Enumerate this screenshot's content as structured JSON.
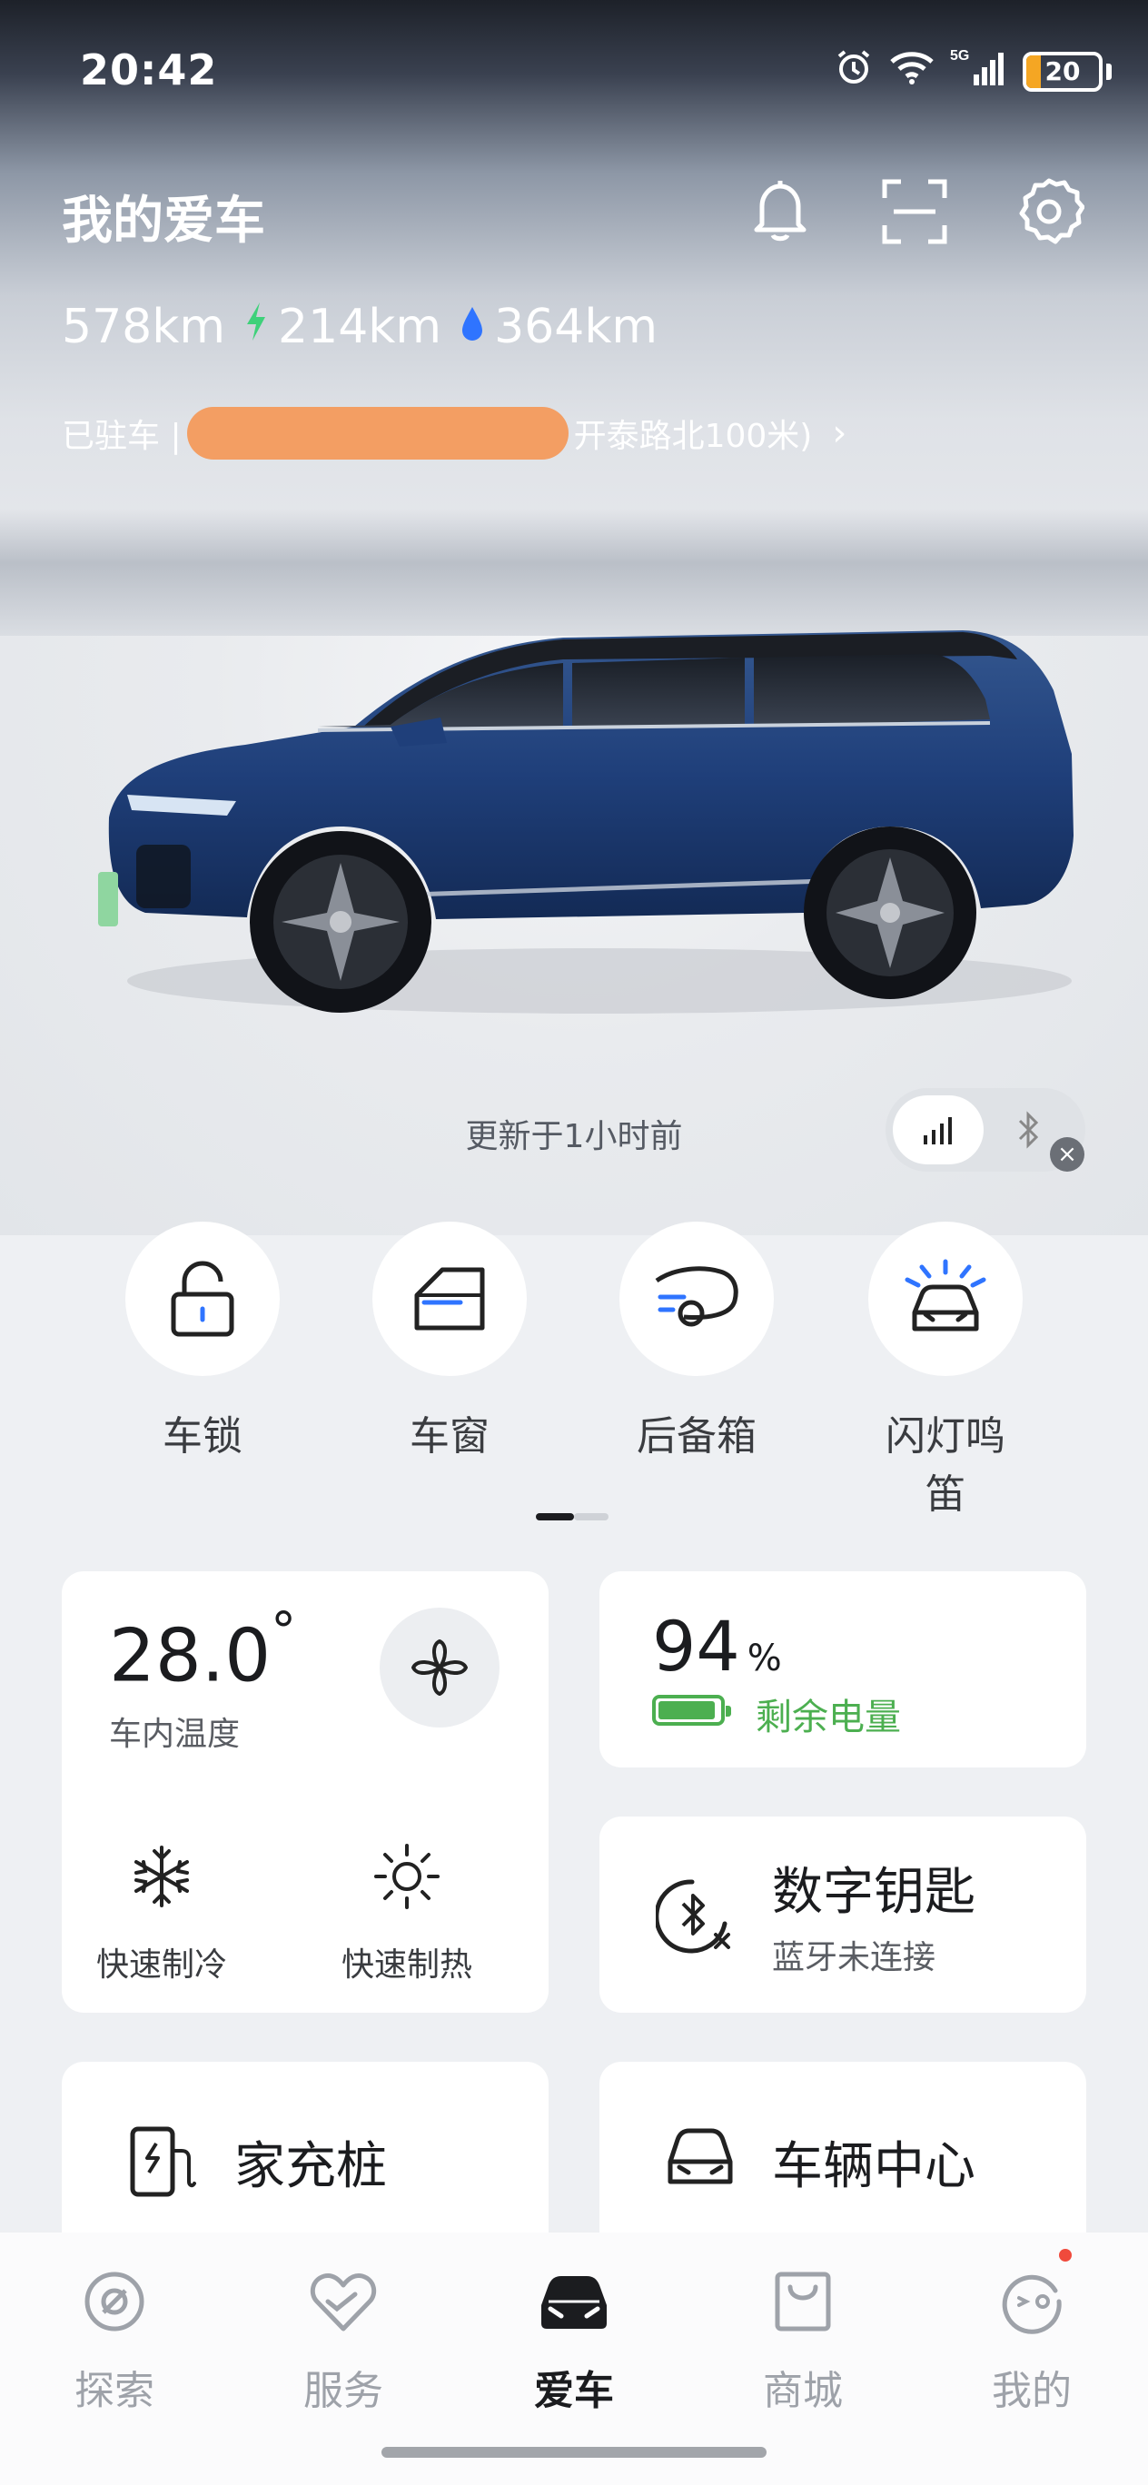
{
  "status": {
    "time": "20:42",
    "battery": "20",
    "network": "5G"
  },
  "header": {
    "title": "我的爱车"
  },
  "range": {
    "total": "578km",
    "electric": "214km",
    "fuel": "364km"
  },
  "parking": {
    "status": "已驻车 |",
    "location_tail": "开泰路北100米)"
  },
  "update": {
    "text": "更新于1小时前"
  },
  "quick_controls": [
    {
      "label": "车锁"
    },
    {
      "label": "车窗"
    },
    {
      "label": "后备箱"
    },
    {
      "label": "闪灯鸣笛"
    }
  ],
  "climate": {
    "temp": "28.0",
    "temp_unit": "°",
    "temp_label": "车内温度",
    "cool_label": "快速制冷",
    "heat_label": "快速制热"
  },
  "battery": {
    "percent": "94",
    "unit": "%",
    "label": "剩余电量",
    "level": 0.94
  },
  "digital_key": {
    "title": "数字钥匙",
    "status": "蓝牙未连接"
  },
  "shortcuts": [
    {
      "label": "家充桩"
    },
    {
      "label": "车辆中心"
    }
  ],
  "tabs": [
    {
      "label": "探索"
    },
    {
      "label": "服务"
    },
    {
      "label": "爱车"
    },
    {
      "label": "商城"
    },
    {
      "label": "我的"
    }
  ],
  "colors": {
    "accent_green": "#4caf50",
    "car_blue": "#1f3f7a",
    "redaction": "#f39a5c"
  }
}
